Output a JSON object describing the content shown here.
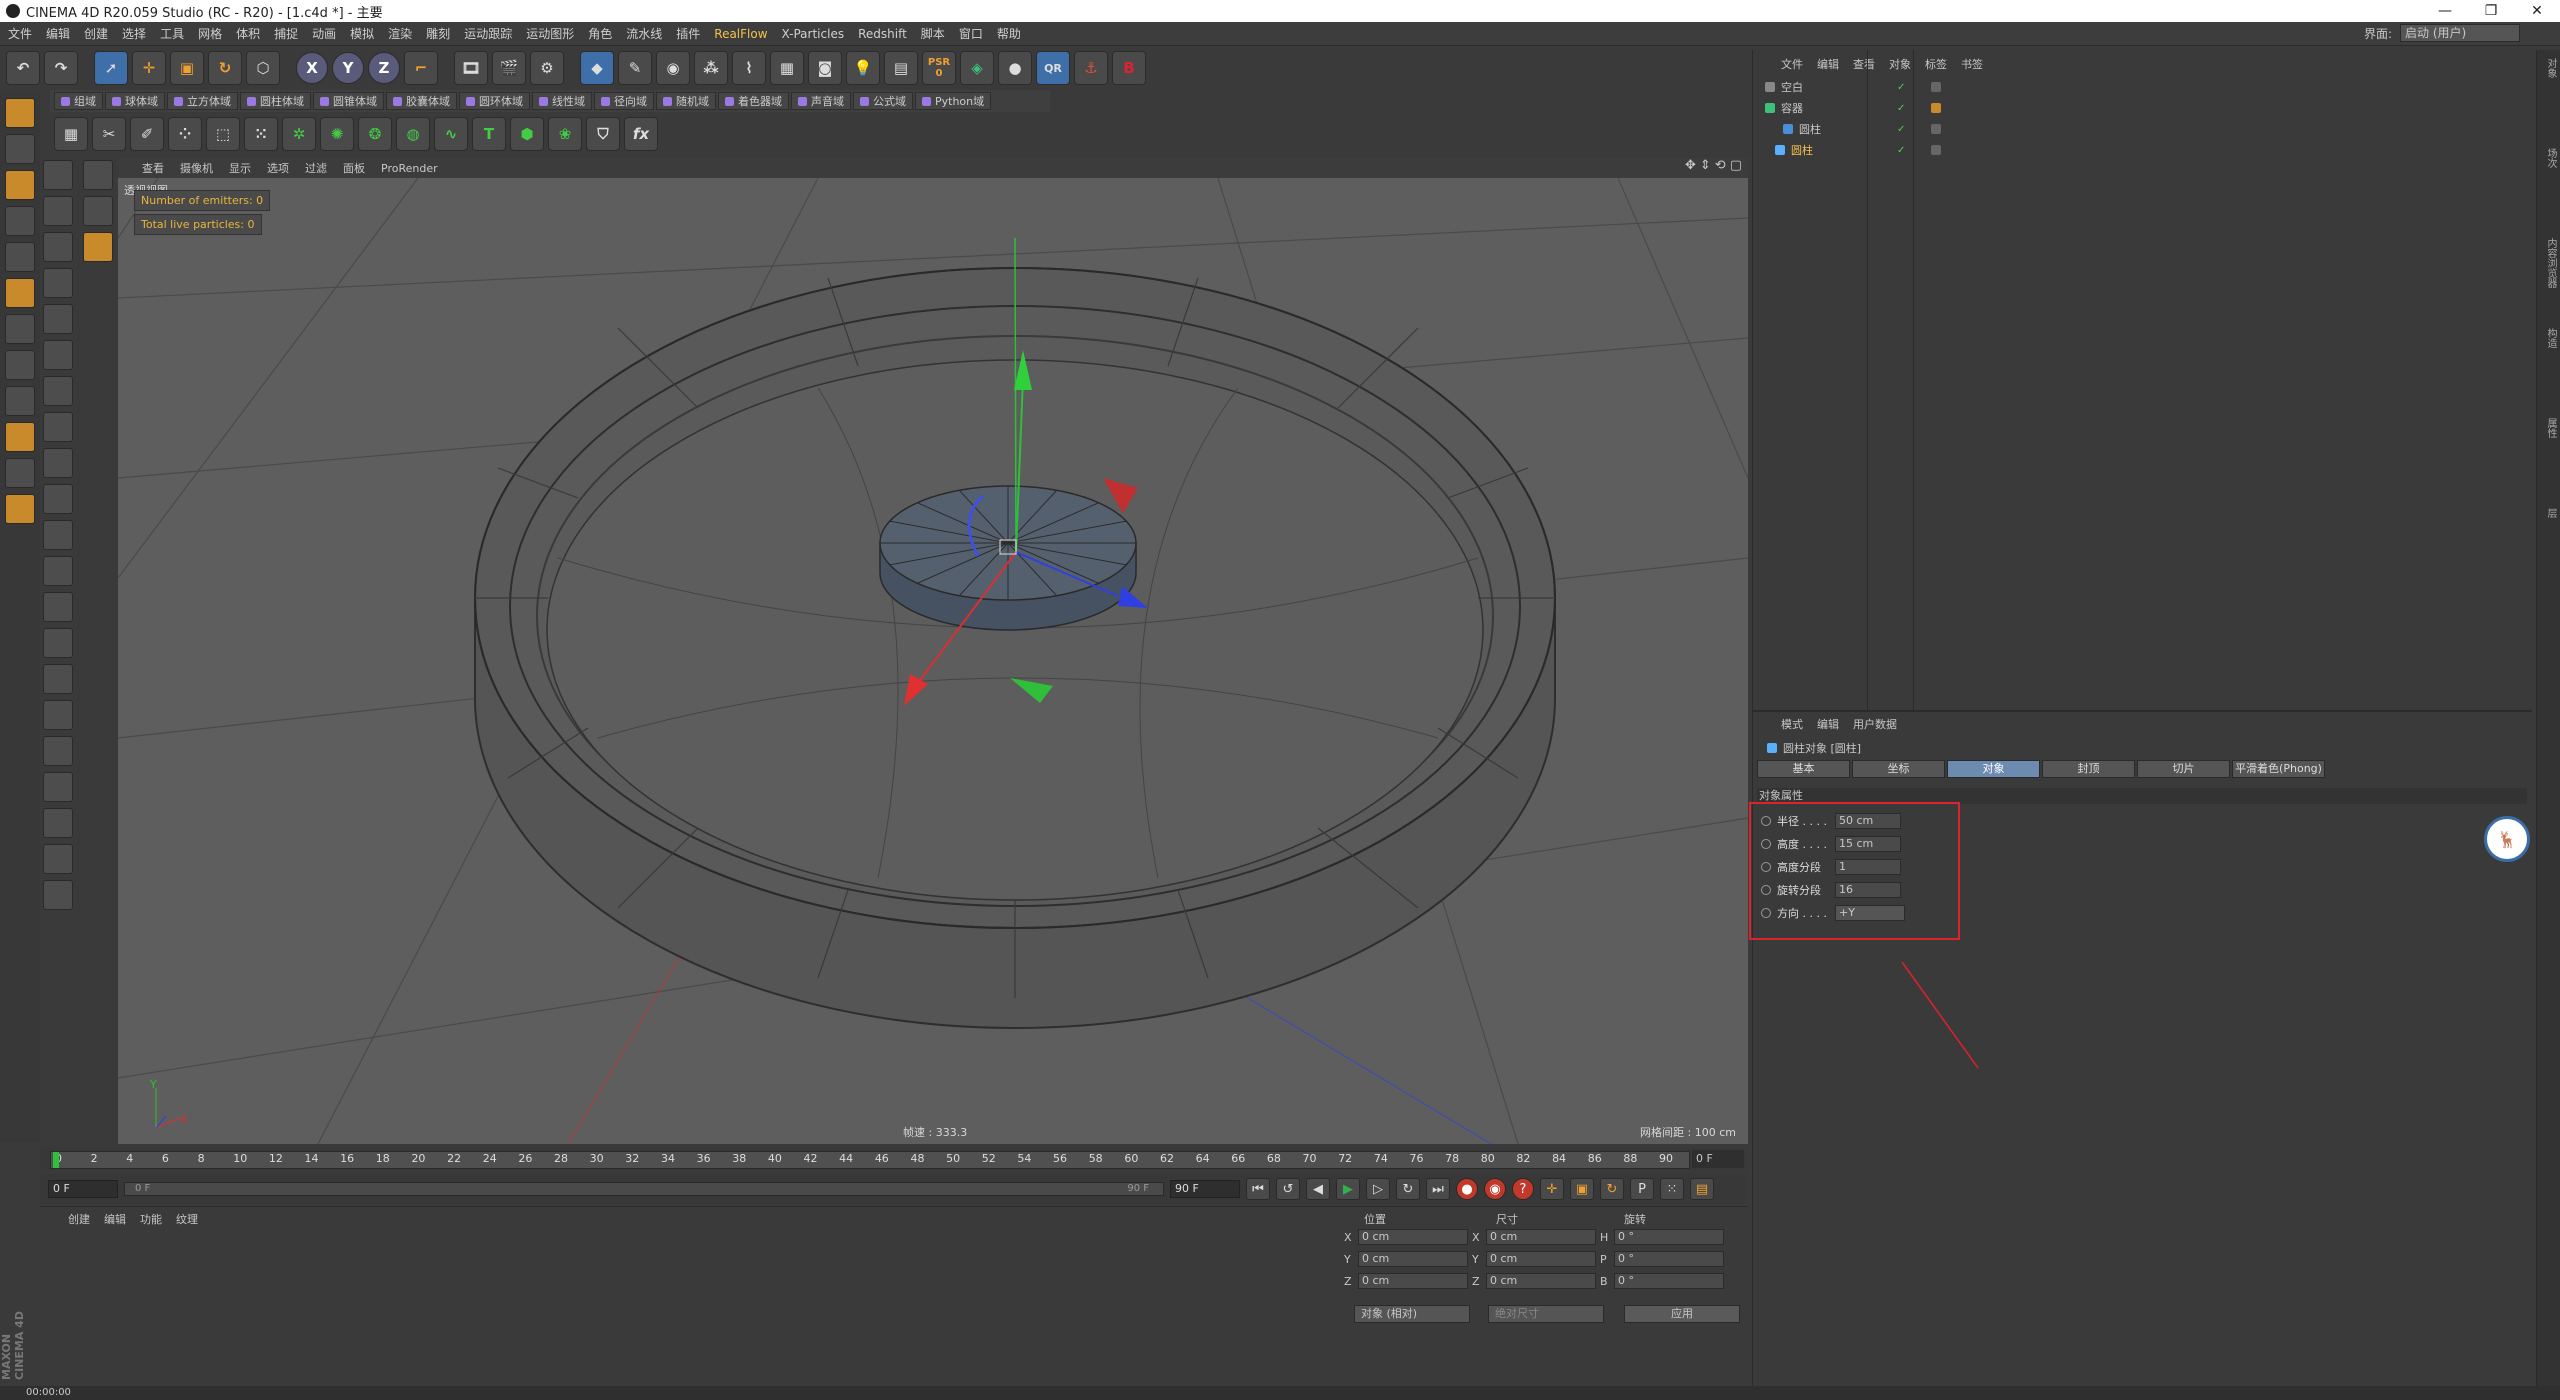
{
  "app": {
    "title": "CINEMA 4D R20.059 Studio (RC - R20) - [1.c4d *] - 主要"
  },
  "window_controls": [
    "—",
    "❐",
    "✕"
  ],
  "menubar": [
    "文件",
    "编辑",
    "创建",
    "选择",
    "工具",
    "网格",
    "体积",
    "捕捉",
    "动画",
    "模拟",
    "渲染",
    "雕刻",
    "运动跟踪",
    "运动图形",
    "角色",
    "流水线",
    "插件",
    "RealFlow",
    "X-Particles",
    "Redshift",
    "脚本",
    "窗口",
    "帮助"
  ],
  "layout": {
    "label": "界面:",
    "value": "启动 (用户)"
  },
  "toolbar_main": {
    "icons": [
      "undo-icon",
      "redo-icon",
      "select-icon",
      "move-icon",
      "scale-icon",
      "rotate-icon",
      "object-icon",
      "x-axis-icon",
      "y-axis-icon",
      "z-axis-icon",
      "coord-icon",
      "render-view-icon",
      "render-icon",
      "render-settings-icon",
      "cube-icon",
      "pen-icon",
      "subdivision-icon",
      "array-icon",
      "deformer-icon",
      "floor-icon",
      "camera-icon",
      "light-icon",
      "tag-icon",
      "psr-icon",
      "xpresso-icon",
      "sphere-icon",
      "qr-icon",
      "anchor-icon",
      "redshift-icon"
    ],
    "axis_labels": [
      "X",
      "Y",
      "Z"
    ],
    "psr_label": "PSR",
    "psr_value": "0"
  },
  "xp_toolbar": [
    "组域",
    "球体域",
    "立方体域",
    "圆柱体域",
    "圆锥体域",
    "胶囊体域",
    "圆环体域",
    "线性域",
    "径向域",
    "随机域",
    "着色器域",
    "声音域",
    "公式域",
    "Python域"
  ],
  "viewport": {
    "menu": [
      "查看",
      "摄像机",
      "显示",
      "选项",
      "过滤",
      "面板",
      "ProRender"
    ],
    "label": "透视视图",
    "hud_emitters": "Number of emitters: 0",
    "hud_particles": "Total live particles: 0",
    "speed": "帧速 : 333.3",
    "grid": "网格间距 : 100 cm",
    "axis_y": "Y",
    "axis_x": "X"
  },
  "timeline": {
    "ticks": [
      "0",
      "2",
      "4",
      "6",
      "8",
      "10",
      "12",
      "14",
      "16",
      "18",
      "20",
      "22",
      "24",
      "26",
      "28",
      "30",
      "32",
      "34",
      "36",
      "38",
      "40",
      "42",
      "44",
      "46",
      "48",
      "50",
      "52",
      "54",
      "56",
      "58",
      "60",
      "62",
      "64",
      "66",
      "68",
      "70",
      "72",
      "74",
      "76",
      "78",
      "80",
      "82",
      "84",
      "86",
      "88",
      "90"
    ],
    "current": "0 F"
  },
  "transport": {
    "start": "0 F",
    "slider_start": "0 F",
    "slider_end": "90 F",
    "end": "90 F"
  },
  "material_panel": {
    "menu": [
      "创建",
      "编辑",
      "功能",
      "纹理"
    ]
  },
  "coord_panel": {
    "headers": [
      "位置",
      "尺寸",
      "旋转"
    ],
    "rows": [
      {
        "axis": "X",
        "pos": "0 cm",
        "saxis": "X",
        "size": "0 cm",
        "raxis": "H",
        "rot": "0 °"
      },
      {
        "axis": "Y",
        "pos": "0 cm",
        "saxis": "Y",
        "size": "0 cm",
        "raxis": "P",
        "rot": "0 °"
      },
      {
        "axis": "Z",
        "pos": "0 cm",
        "saxis": "Z",
        "size": "0 cm",
        "raxis": "B",
        "rot": "0 °"
      }
    ],
    "mode": "对象 (相对)",
    "size_mode": "绝对尺寸",
    "apply": "应用"
  },
  "status": {
    "time": "00:00:00"
  },
  "maxon": "MAXON CINEMA 4D",
  "object_panel": {
    "menu": [
      "文件",
      "编辑",
      "查看",
      "对象",
      "标签",
      "书签"
    ],
    "objects": [
      "空白",
      "容器",
      "圆柱",
      "圆柱"
    ]
  },
  "attr_panel": {
    "menu": [
      "模式",
      "编辑",
      "用户数据"
    ],
    "title": "圆柱对象 [圆柱]",
    "tabs": [
      "基本",
      "坐标",
      "对象",
      "封顶",
      "切片",
      "平滑着色(Phong)"
    ],
    "section": "对象属性",
    "props": [
      {
        "label": "半径 . . . .",
        "value": "50 cm"
      },
      {
        "label": "高度 . . . .",
        "value": "15 cm"
      },
      {
        "label": "高度分段",
        "value": "1"
      },
      {
        "label": "旋转分段",
        "value": "16"
      },
      {
        "label": "方向 . . . .",
        "value": "+Y"
      }
    ]
  },
  "right_tabs": [
    "对象",
    "场次",
    "内容浏览器",
    "构造",
    "属性",
    "层"
  ],
  "colors": {
    "bg": "#3a3a3a",
    "viewport": "#5e5e5e",
    "accent": "#6d8bb0",
    "highlight_red": "#e0222a",
    "y_axis": "#2fbf3a",
    "x_axis": "#d83030",
    "z_axis": "#3040e0"
  }
}
